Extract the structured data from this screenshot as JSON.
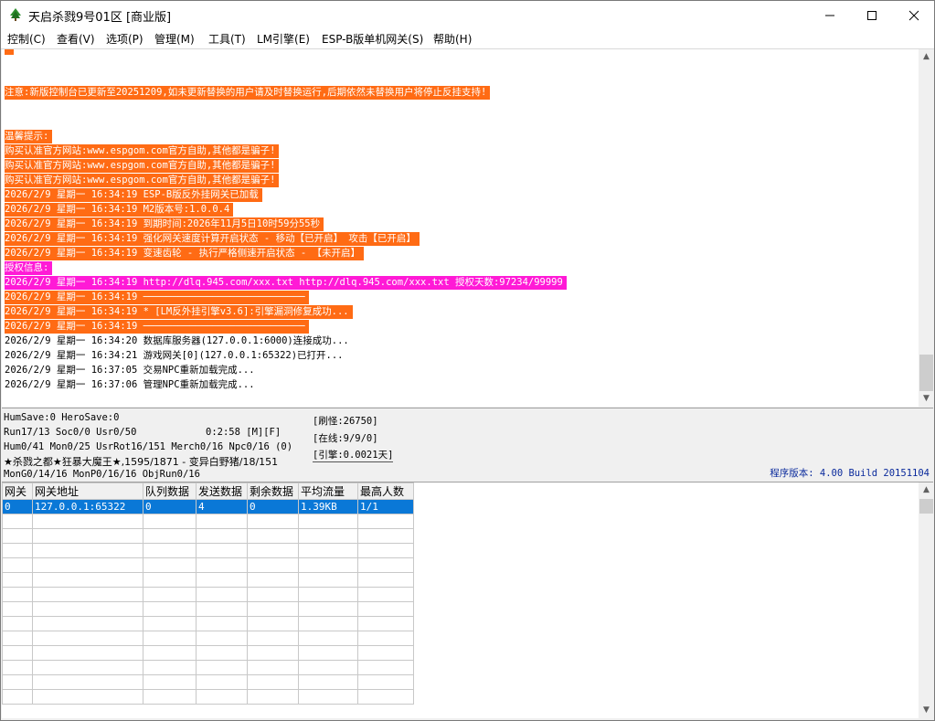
{
  "window": {
    "title": "天启杀戮9号01区 [商业版]"
  },
  "icons": {
    "app": "tree-icon",
    "minimize": "minimize-icon",
    "maximize": "maximize-icon",
    "close": "close-icon"
  },
  "menu": [
    "控制(C)",
    "查看(V)",
    "选项(P)",
    "管理(M)",
    "工具(T)",
    "LM引擎(E)",
    "ESP-B版单机网关(S)",
    "帮助(H)"
  ],
  "log": [
    {
      "text": "注意:新版控制台已更新至20251209,如未更新替换的用户请及时替换运行,后期依然未替换用户将停止反挂支持!",
      "style": "o"
    },
    {
      "text": "",
      "style": "n"
    },
    {
      "text": "",
      "style": "n"
    },
    {
      "text": "温馨提示:",
      "style": "o"
    },
    {
      "text": "购买认准官方网站:www.espgom.com官方自助,其他都是骗子!",
      "style": "o"
    },
    {
      "text": "购买认准官方网站:www.espgom.com官方自助,其他都是骗子!",
      "style": "o"
    },
    {
      "text": "购买认准官方网站:www.espgom.com官方自助,其他都是骗子!",
      "style": "o"
    },
    {
      "text": "2026/2/9 星期一 16:34:19 ESP-B版反外挂网关已加载",
      "style": "o"
    },
    {
      "text": "2026/2/9 星期一 16:34:19 M2版本号:1.0.0.4",
      "style": "o"
    },
    {
      "text": "2026/2/9 星期一 16:34:19 到期时间:2026年11月5日10时59分55秒",
      "style": "o"
    },
    {
      "text": "2026/2/9 星期一 16:34:19 强化网关速度计算开启状态 - 移动【已开启】 攻击【已开启】",
      "style": "o"
    },
    {
      "text": "2026/2/9 星期一 16:34:19 变速齿轮 - 执行严格侧速开启状态 - 【未开启】",
      "style": "o"
    },
    {
      "text": "授权信息:",
      "style": "m"
    },
    {
      "text": "2026/2/9 星期一 16:34:19 http://dlq.945.com/xxx.txt http://dlq.945.com/xxx.txt 授权天数:97234/99999",
      "style": "m"
    },
    {
      "text": "2026/2/9 星期一 16:34:19 ────────────────────────────",
      "style": "o"
    },
    {
      "text": "2026/2/9 星期一 16:34:19 * [LM反外挂引擎v3.6]:引擎漏洞修复成功...",
      "style": "o"
    },
    {
      "text": "2026/2/9 星期一 16:34:19 ────────────────────────────",
      "style": "o"
    },
    {
      "text": "2026/2/9 星期一 16:34:20 数据库服务器(127.0.0.1:6000)连接成功...",
      "style": "n"
    },
    {
      "text": "2026/2/9 星期一 16:34:21 游戏网关[0](127.0.0.1:65322)已打开...",
      "style": "n"
    },
    {
      "text": "2026/2/9 星期一 16:37:05 交易NPC重新加载完成...",
      "style": "n"
    },
    {
      "text": "2026/2/9 星期一 16:37:06 管理NPC重新加载完成...",
      "style": "n"
    }
  ],
  "status": {
    "line1": "HumSave:0 HeroSave:0",
    "line2": "Run17/13 Soc0/0 Usr0/50",
    "runtime": "0:2:58 [M][F]",
    "line3": "Hum0/41 Mon0/25 UsrRot16/151 Merch0/16 Npc0/16 (0)",
    "line4": "★杀戮之都★狂暴大魔王★,1595/1871 - 变异白野猪/18/151",
    "line5": "MonG0/14/16 MonP0/16/16 ObjRun0/16",
    "refresh": "[刷怪:26750]",
    "online": "[在线:9/9/0]",
    "engine": "[引擎:0.0021天]",
    "version": "程序版本: 4.00 Build 20151104"
  },
  "grid": {
    "columns": [
      "网关",
      "网关地址",
      "队列数据",
      "发送数据",
      "剩余数据",
      "平均流量",
      "最高人数"
    ],
    "rows": [
      [
        "0",
        "127.0.0.1:65322",
        "0",
        "4",
        "0",
        "1.39KB",
        "1/1"
      ]
    ]
  }
}
